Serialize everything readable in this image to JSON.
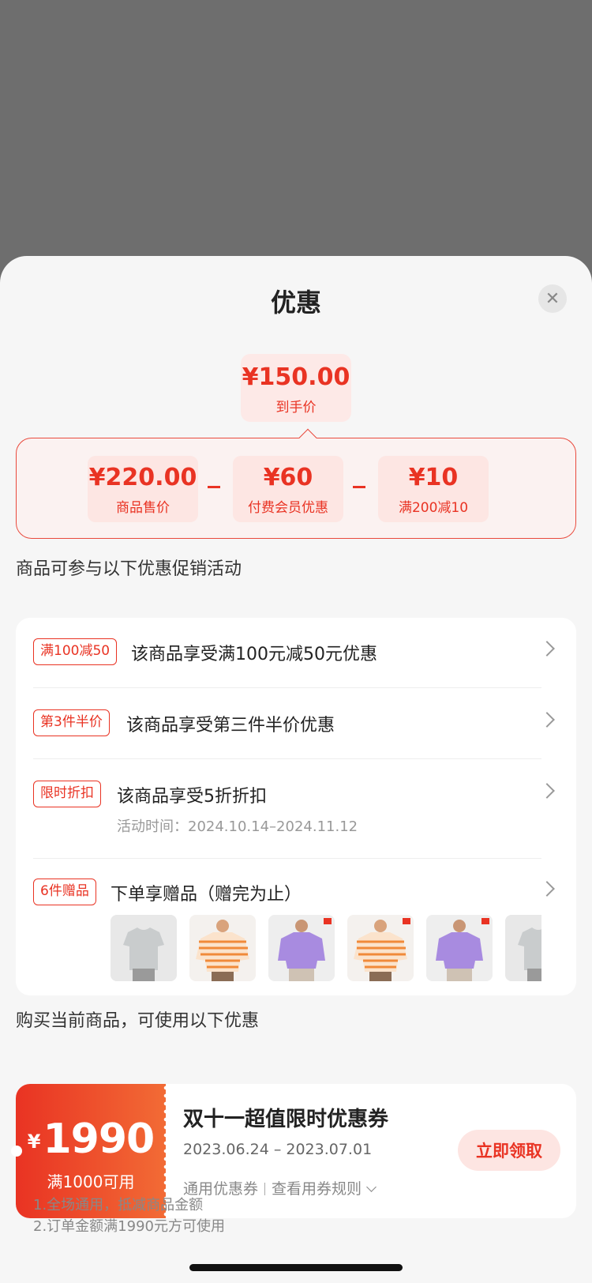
{
  "sheet": {
    "title": "优惠",
    "close_icon": "close-icon"
  },
  "final_price": {
    "amount": "¥150.00",
    "label": "到手价"
  },
  "breakdown": [
    {
      "amount": "¥220.00",
      "label": "商品售价"
    },
    {
      "amount": "¥60",
      "label": "付费会员优惠"
    },
    {
      "amount": "¥10",
      "label": "满200减10"
    }
  ],
  "promotions": {
    "section_title": "商品可参与以下优惠促销活动",
    "items": [
      {
        "tag": "满100减50",
        "text": "该商品享受满100元减50元优惠"
      },
      {
        "tag": "第3件半价",
        "text": "该商品享受第三件半价优惠"
      },
      {
        "tag": "限时折扣",
        "text": "该商品享受5折折扣",
        "sub": "活动时间：2024.10.14–2024.11.12"
      },
      {
        "tag": "6件赠品",
        "text": "下单享赠品（赠完为止）"
      }
    ],
    "gift_images": [
      "grey-tshirt-image",
      "orange-striped-sweater-image",
      "purple-sweater-image",
      "orange-striped-sweater-image",
      "purple-sweater-image",
      "grey-tshirt-image"
    ]
  },
  "coupons": {
    "section_title": "购买当前商品，可使用以下优惠",
    "items": [
      {
        "currency": "¥",
        "value": "1990",
        "condition": "满1000可用",
        "title": "双十一超值限时优惠券",
        "date": "2023.06.24 – 2023.07.01",
        "type": "通用优惠券",
        "rules_link": "查看用券规则",
        "button": "立即领取",
        "rules": [
          "1.全场通用，抵减商品金额",
          "2.订单金额满1990元方可使用"
        ]
      }
    ]
  },
  "colors": {
    "accent": "#e93323",
    "accent_light": "#fde6e3",
    "background": "#f6f6f6"
  }
}
